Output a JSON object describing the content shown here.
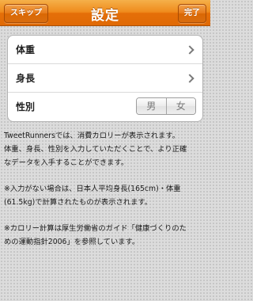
{
  "navbar": {
    "title": "設定",
    "skip_label": "スキップ",
    "done_label": "完了"
  },
  "settings": {
    "rows": [
      {
        "label": "体重"
      },
      {
        "label": "身長"
      },
      {
        "label": "性別"
      }
    ],
    "gender_options": [
      "男",
      "女"
    ]
  },
  "notes": {
    "p1": "TweetRunnersでは、消費カロリーが表示されます。\n体重、身長、性別を入力していただくことで、より正確\nなデータを入手することができます。",
    "p2": "※入力がない場合は、日本人平均身長(165cm)・体重\n(61.5kg)で計算されたものが表示されます。",
    "p3": "※カロリー計算は厚生労働省のガイド「健康づくりのた\nめの運動指針2006」を参照しています。"
  }
}
